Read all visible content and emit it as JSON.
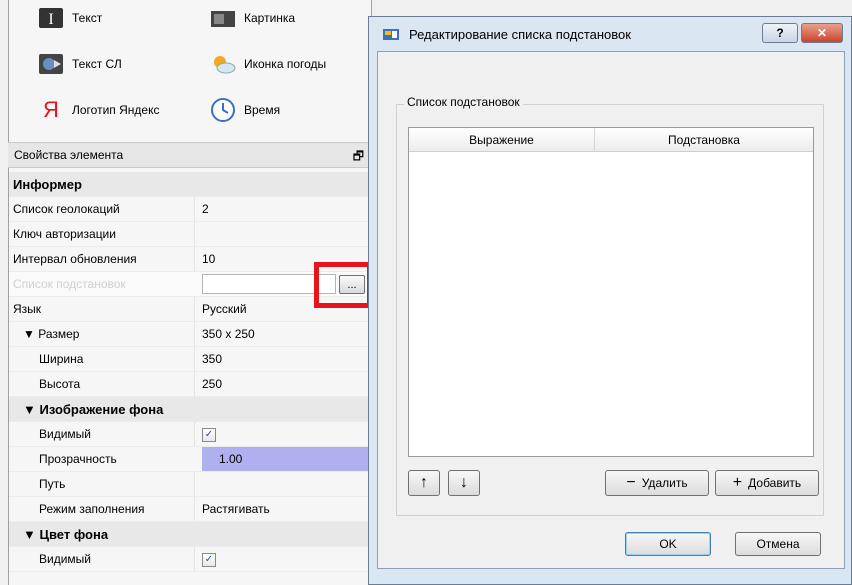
{
  "toolbox": {
    "items": [
      {
        "label": "Текст",
        "icon": "text-icon"
      },
      {
        "label": "Картинка",
        "icon": "image-icon"
      },
      {
        "label": "Текст СЛ",
        "icon": "textsl-icon"
      },
      {
        "label": "Иконка погоды",
        "icon": "weather-icon"
      },
      {
        "label": "Логотип Яндекс",
        "icon": "yandex-icon"
      },
      {
        "label": "Время",
        "icon": "clock-icon"
      }
    ]
  },
  "props": {
    "header": "Свойства элемента",
    "rows": [
      {
        "key": "Информер",
        "value": ""
      },
      {
        "key": "Список геолокаций",
        "value": "2"
      },
      {
        "key": "Ключ авторизации",
        "value": ""
      },
      {
        "key": "Интервал обновления",
        "value": "10"
      },
      {
        "key": "Список подстановок",
        "value": "",
        "button": "..."
      },
      {
        "key": "Язык",
        "value": "Русский"
      },
      {
        "key": "Размер",
        "value": "350 x 250"
      },
      {
        "key": "Ширина",
        "value": "350"
      },
      {
        "key": "Высота",
        "value": "250"
      },
      {
        "key": "Изображение фона",
        "value": ""
      },
      {
        "key": "Видимый",
        "value": ""
      },
      {
        "key": "Прозрачность",
        "value": "1.00"
      },
      {
        "key": "Путь",
        "value": ""
      },
      {
        "key": "Режим заполнения",
        "value": "Растягивать"
      },
      {
        "key": "Цвет фона",
        "value": ""
      },
      {
        "key": "Видимый",
        "value": ""
      }
    ]
  },
  "dialog": {
    "title": "Редактирование списка подстановок",
    "help_label": "?",
    "close_label": "✕",
    "group_label": "Список подстановок",
    "columns": [
      "Выражение",
      "Подстановка"
    ],
    "buttons": {
      "up": "↑",
      "down": "↓",
      "remove": "Удалить",
      "add": "Добавить",
      "ok": "OK",
      "cancel": "Отмена"
    }
  },
  "colors": {
    "highlight_red": "#e8141c",
    "value_highlight": "#b0b0f0",
    "titlebar": "#d7e4f2"
  }
}
